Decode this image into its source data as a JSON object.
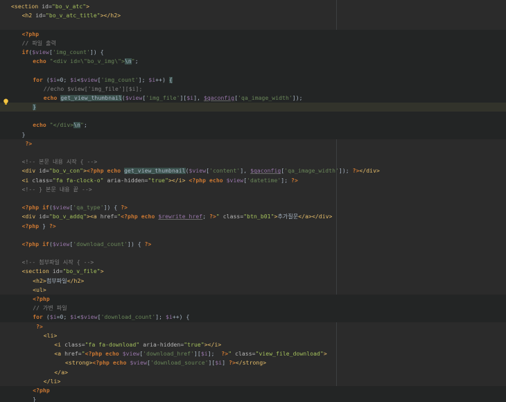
{
  "editor": {
    "lines": [
      {
        "indent": 0,
        "bg": "",
        "tokens": [
          [
            "tag",
            "<section "
          ],
          [
            "attr",
            "id="
          ],
          [
            "aval",
            "\"bo_v_atc\""
          ],
          [
            "tag",
            ">"
          ]
        ]
      },
      {
        "indent": 1,
        "bg": "",
        "tokens": [
          [
            "tag",
            "<h2 "
          ],
          [
            "attr",
            "id="
          ],
          [
            "aval",
            "\"bo_v_atc_title\""
          ],
          [
            "tag",
            "></h2>"
          ]
        ]
      },
      {
        "indent": 0,
        "bg": "",
        "tokens": []
      },
      {
        "indent": 1,
        "bg": "php",
        "tokens": [
          [
            "php",
            "<?php"
          ]
        ]
      },
      {
        "indent": 1,
        "bg": "php",
        "tokens": [
          [
            "com",
            "// 파일 출력"
          ]
        ]
      },
      {
        "indent": 1,
        "bg": "php",
        "tokens": [
          [
            "kw",
            "if"
          ],
          [
            "op",
            "("
          ],
          [
            "var",
            "$view"
          ],
          [
            "op",
            "["
          ],
          [
            "str",
            "'img_count'"
          ],
          [
            "op",
            "]) {"
          ]
        ]
      },
      {
        "indent": 2,
        "bg": "php",
        "tokens": [
          [
            "kw",
            "echo "
          ],
          [
            "str",
            "\"<div id=\\\"bo_v_img\\\">"
          ],
          [
            "hl",
            "\\n"
          ],
          [
            "str",
            "\""
          ],
          [
            "op",
            ";"
          ]
        ]
      },
      {
        "indent": 0,
        "bg": "php",
        "tokens": []
      },
      {
        "indent": 2,
        "bg": "php",
        "tokens": [
          [
            "kw",
            "for "
          ],
          [
            "op",
            "("
          ],
          [
            "var",
            "$i"
          ],
          [
            "op",
            "=0; "
          ],
          [
            "var",
            "$i"
          ],
          [
            "op",
            "<"
          ],
          [
            "var",
            "$view"
          ],
          [
            "op",
            "["
          ],
          [
            "str",
            "'img_count'"
          ],
          [
            "op",
            "]; "
          ],
          [
            "var",
            "$i"
          ],
          [
            "op",
            "++) "
          ],
          [
            "hl",
            "{"
          ]
        ]
      },
      {
        "indent": 3,
        "bg": "php",
        "tokens": [
          [
            "com",
            "//echo $view['img_file'][$i];"
          ]
        ]
      },
      {
        "indent": 3,
        "bg": "php",
        "tokens": [
          [
            "kw",
            "echo "
          ],
          [
            "hl",
            "get_view_thumbnail"
          ],
          [
            "op",
            "("
          ],
          [
            "var",
            "$view"
          ],
          [
            "op",
            "["
          ],
          [
            "str",
            "'img_file'"
          ],
          [
            "op",
            "]["
          ],
          [
            "var",
            "$i"
          ],
          [
            "op",
            "], "
          ],
          [
            "glob",
            "$qaconfig"
          ],
          [
            "op",
            "["
          ],
          [
            "str",
            "'qa_image_width'"
          ],
          [
            "op",
            "]);"
          ]
        ]
      },
      {
        "indent": 2,
        "bg": "current",
        "tokens": [
          [
            "hl",
            "}"
          ]
        ]
      },
      {
        "indent": 0,
        "bg": "php",
        "tokens": []
      },
      {
        "indent": 2,
        "bg": "php",
        "tokens": [
          [
            "kw",
            "echo "
          ],
          [
            "str",
            "\"</div>"
          ],
          [
            "hl",
            "\\n"
          ],
          [
            "str",
            "\""
          ],
          [
            "op",
            ";"
          ]
        ]
      },
      {
        "indent": 1,
        "bg": "php",
        "tokens": [
          [
            "op",
            "}"
          ]
        ]
      },
      {
        "indent": 1,
        "bg": "",
        "tokens": [
          [
            "php",
            " ?>"
          ]
        ]
      },
      {
        "indent": 0,
        "bg": "",
        "tokens": []
      },
      {
        "indent": 1,
        "bg": "",
        "tokens": [
          [
            "com",
            "<!-- 본문 내용 시작 { -->"
          ]
        ]
      },
      {
        "indent": 1,
        "bg": "",
        "tokens": [
          [
            "tag",
            "<div "
          ],
          [
            "attr",
            "id="
          ],
          [
            "aval",
            "\"bo_v_con\""
          ],
          [
            "tag",
            ">"
          ],
          [
            "php",
            "<?php "
          ],
          [
            "kw",
            "echo "
          ],
          [
            "hl",
            "get_view_thumbnail"
          ],
          [
            "op",
            "("
          ],
          [
            "var",
            "$view"
          ],
          [
            "op",
            "["
          ],
          [
            "str",
            "'content'"
          ],
          [
            "op",
            "], "
          ],
          [
            "glob",
            "$qaconfig"
          ],
          [
            "op",
            "["
          ],
          [
            "str",
            "'qa_image_width'"
          ],
          [
            "op",
            "]); "
          ],
          [
            "php",
            "?>"
          ],
          [
            "tag",
            "</div>"
          ]
        ]
      },
      {
        "indent": 1,
        "bg": "",
        "tokens": [
          [
            "tag",
            "<i "
          ],
          [
            "attr",
            "class="
          ],
          [
            "aval",
            "\"fa fa-clock-o\" "
          ],
          [
            "attr",
            "aria-hidden="
          ],
          [
            "aval",
            "\"true\""
          ],
          [
            "tag",
            "></i> "
          ],
          [
            "php",
            "<?php "
          ],
          [
            "kw",
            "echo "
          ],
          [
            "var",
            "$view"
          ],
          [
            "op",
            "["
          ],
          [
            "str",
            "'datetime'"
          ],
          [
            "op",
            "]; "
          ],
          [
            "php",
            "?>"
          ]
        ]
      },
      {
        "indent": 1,
        "bg": "",
        "tokens": [
          [
            "com",
            "<!-- } 본문 내용 끝 -->"
          ]
        ]
      },
      {
        "indent": 0,
        "bg": "",
        "tokens": []
      },
      {
        "indent": 1,
        "bg": "",
        "tokens": [
          [
            "php",
            "<?php "
          ],
          [
            "kw",
            "if"
          ],
          [
            "op",
            "("
          ],
          [
            "var",
            "$view"
          ],
          [
            "op",
            "["
          ],
          [
            "str",
            "'qa_type'"
          ],
          [
            "op",
            "]) { "
          ],
          [
            "php",
            "?>"
          ]
        ]
      },
      {
        "indent": 1,
        "bg": "",
        "tokens": [
          [
            "tag",
            "<div "
          ],
          [
            "attr",
            "id="
          ],
          [
            "aval",
            "\"bo_v_addq\""
          ],
          [
            "tag",
            ">"
          ],
          [
            "tag",
            "<a "
          ],
          [
            "attr",
            "href="
          ],
          [
            "aval",
            "\""
          ],
          [
            "php",
            "<?php "
          ],
          [
            "kw",
            "echo "
          ],
          [
            "glob",
            "$rewrite_href"
          ],
          [
            "op",
            "; "
          ],
          [
            "php",
            "?>"
          ],
          [
            "aval",
            "\" "
          ],
          [
            "attr",
            "class="
          ],
          [
            "aval",
            "\"btn_b01\""
          ],
          [
            "tag",
            ">"
          ],
          [
            "txt",
            "추가질문"
          ],
          [
            "tag",
            "</a></div>"
          ]
        ]
      },
      {
        "indent": 1,
        "bg": "",
        "tokens": [
          [
            "php",
            "<?php "
          ],
          [
            "op",
            "} "
          ],
          [
            "php",
            "?>"
          ]
        ]
      },
      {
        "indent": 0,
        "bg": "",
        "tokens": []
      },
      {
        "indent": 1,
        "bg": "",
        "tokens": [
          [
            "php",
            "<?php "
          ],
          [
            "kw",
            "if"
          ],
          [
            "op",
            "("
          ],
          [
            "var",
            "$view"
          ],
          [
            "op",
            "["
          ],
          [
            "str",
            "'download_count'"
          ],
          [
            "op",
            "]) { "
          ],
          [
            "php",
            "?>"
          ]
        ]
      },
      {
        "indent": 0,
        "bg": "",
        "tokens": []
      },
      {
        "indent": 1,
        "bg": "",
        "tokens": [
          [
            "com",
            "<!-- 첨부파일 시작 { -->"
          ]
        ]
      },
      {
        "indent": 1,
        "bg": "",
        "tokens": [
          [
            "tag",
            "<section "
          ],
          [
            "attr",
            "id="
          ],
          [
            "aval",
            "\"bo_v_file\""
          ],
          [
            "tag",
            ">"
          ]
        ]
      },
      {
        "indent": 2,
        "bg": "",
        "tokens": [
          [
            "tag",
            "<h2>"
          ],
          [
            "txt",
            "첨부파일"
          ],
          [
            "tag",
            "</h2>"
          ]
        ]
      },
      {
        "indent": 2,
        "bg": "",
        "tokens": [
          [
            "tag",
            "<ul>"
          ]
        ]
      },
      {
        "indent": 2,
        "bg": "php",
        "tokens": [
          [
            "php",
            "<?php"
          ]
        ]
      },
      {
        "indent": 2,
        "bg": "php",
        "tokens": [
          [
            "com",
            "// 가변 파일"
          ]
        ]
      },
      {
        "indent": 2,
        "bg": "php",
        "tokens": [
          [
            "kw",
            "for "
          ],
          [
            "op",
            "("
          ],
          [
            "var",
            "$i"
          ],
          [
            "op",
            "=0; "
          ],
          [
            "var",
            "$i"
          ],
          [
            "op",
            "<"
          ],
          [
            "var",
            "$view"
          ],
          [
            "op",
            "["
          ],
          [
            "str",
            "'download_count'"
          ],
          [
            "op",
            "]; "
          ],
          [
            "var",
            "$i"
          ],
          [
            "op",
            "++) {"
          ]
        ]
      },
      {
        "indent": 2,
        "bg": "",
        "tokens": [
          [
            "php",
            " ?>"
          ]
        ]
      },
      {
        "indent": 3,
        "bg": "",
        "tokens": [
          [
            "tag",
            "<li>"
          ]
        ]
      },
      {
        "indent": 4,
        "bg": "",
        "tokens": [
          [
            "tag",
            "<i "
          ],
          [
            "attr",
            "class="
          ],
          [
            "aval",
            "\"fa fa-download\" "
          ],
          [
            "attr",
            "aria-hidden="
          ],
          [
            "aval",
            "\"true\""
          ],
          [
            "tag",
            "></i>"
          ]
        ]
      },
      {
        "indent": 4,
        "bg": "",
        "tokens": [
          [
            "tag",
            "<a "
          ],
          [
            "attr",
            "href="
          ],
          [
            "aval",
            "\""
          ],
          [
            "php",
            "<?php "
          ],
          [
            "kw",
            "echo "
          ],
          [
            "var",
            "$view"
          ],
          [
            "op",
            "["
          ],
          [
            "str",
            "'download_href'"
          ],
          [
            "op",
            "]["
          ],
          [
            "var",
            "$i"
          ],
          [
            "op",
            "];  "
          ],
          [
            "php",
            "?>"
          ],
          [
            "aval",
            "\" "
          ],
          [
            "attr",
            "class="
          ],
          [
            "aval",
            "\"view_file_download\""
          ],
          [
            "tag",
            ">"
          ]
        ]
      },
      {
        "indent": 5,
        "bg": "",
        "tokens": [
          [
            "tag",
            "<strong>"
          ],
          [
            "php",
            "<?php "
          ],
          [
            "kw",
            "echo "
          ],
          [
            "var",
            "$view"
          ],
          [
            "op",
            "["
          ],
          [
            "str",
            "'download_source'"
          ],
          [
            "op",
            "]["
          ],
          [
            "var",
            "$i"
          ],
          [
            "op",
            "] "
          ],
          [
            "php",
            "?>"
          ],
          [
            "tag",
            "</strong>"
          ]
        ]
      },
      {
        "indent": 4,
        "bg": "",
        "tokens": [
          [
            "tag",
            "</a>"
          ]
        ]
      },
      {
        "indent": 3,
        "bg": "",
        "tokens": [
          [
            "tag",
            "</li>"
          ]
        ]
      },
      {
        "indent": 2,
        "bg": "php",
        "tokens": [
          [
            "php",
            "<?php"
          ]
        ]
      },
      {
        "indent": 2,
        "bg": "php",
        "tokens": [
          [
            "op",
            "}"
          ]
        ]
      },
      {
        "indent": 2,
        "bg": "",
        "tokens": [
          [
            "php",
            " ?>"
          ]
        ]
      }
    ]
  },
  "colors": {
    "background": "#2b2b2b",
    "php_block_background": "#232525",
    "current_line": "#32332b",
    "tag": "#e8bf6a",
    "attribute": "#bababa",
    "attribute_value": "#a5c25c",
    "keyword": "#cc7832",
    "variable": "#9876aa",
    "string": "#6a8759",
    "comment": "#808080",
    "text": "#a9b7c6"
  },
  "gutter": {
    "current_line_icon": "lightbulb-icon"
  }
}
